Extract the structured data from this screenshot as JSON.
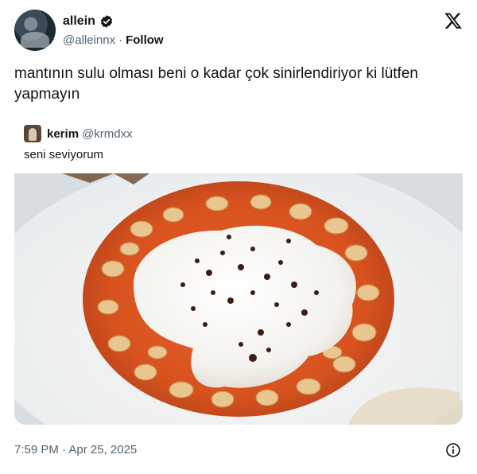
{
  "author": {
    "display_name": "allein",
    "handle": "@alleinnx",
    "follow_label": "Follow",
    "separator": "·"
  },
  "tweet": {
    "text": "mantının sulu olması beni o kadar çok sinirlendiriyor ki lütfen yapmayın",
    "timestamp": "7:59 PM · Apr 25, 2025"
  },
  "quoted": {
    "display_name": "kerim",
    "handle": "@krmdxx",
    "text": "seni seviyorum",
    "image_alt": "mantı with yogurt and pepper butter"
  },
  "icons": {
    "verified": "verified-badge-icon",
    "platform": "x-logo-icon",
    "info": "info-icon"
  },
  "colors": {
    "text": "#0f1419",
    "secondary": "#536471",
    "accent": "#1d9bf0"
  }
}
